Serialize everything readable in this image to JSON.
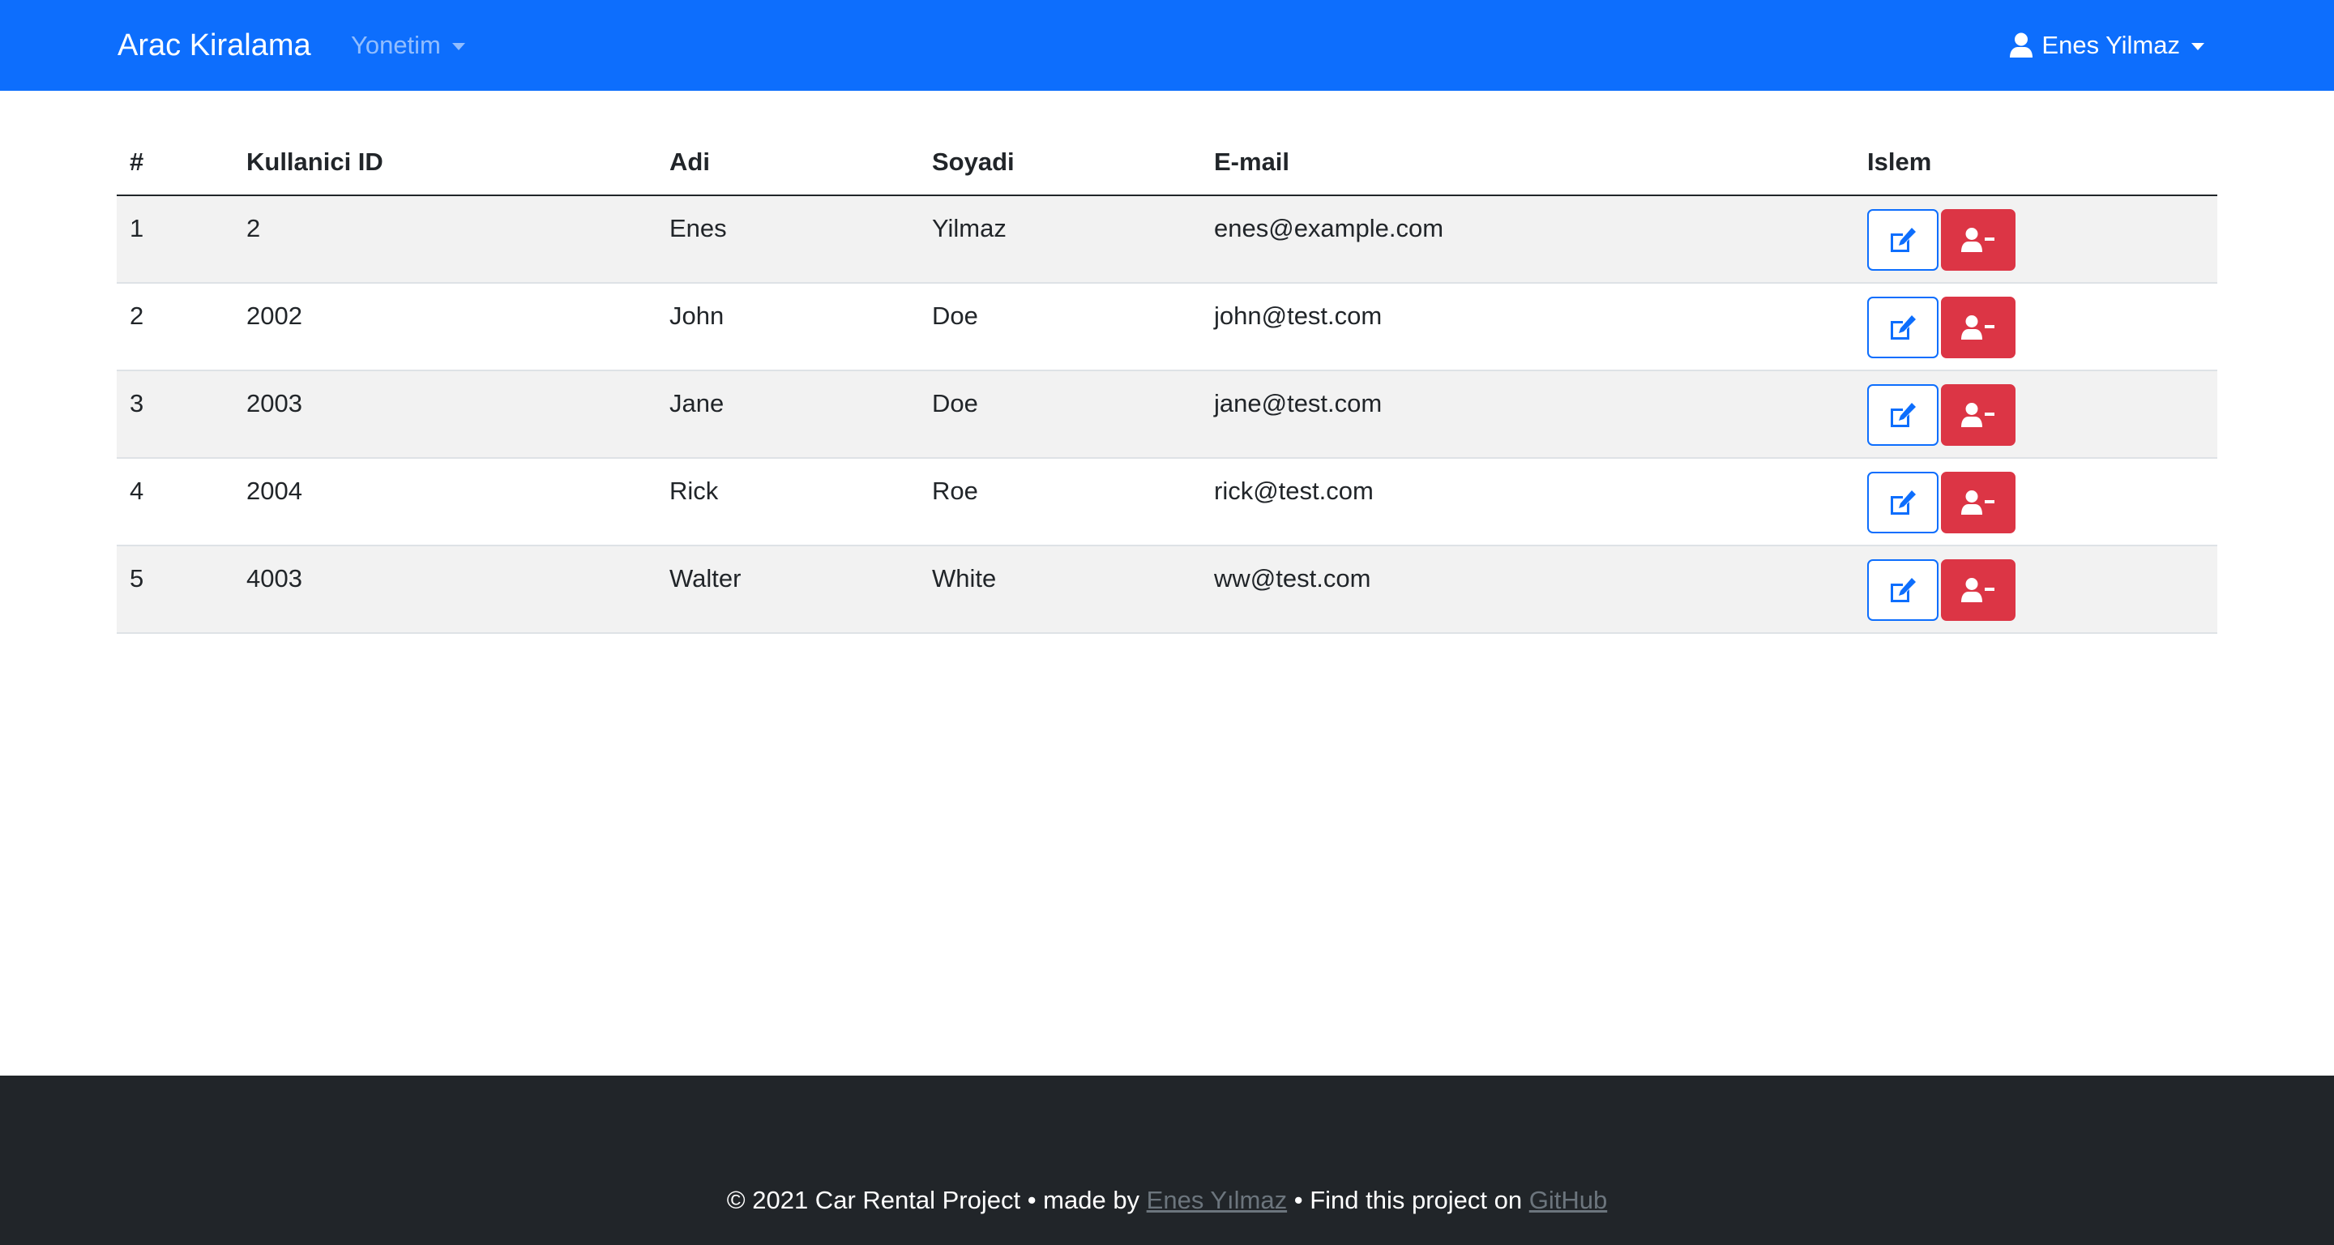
{
  "navbar": {
    "brand": "Arac Kiralama",
    "menu_label": "Yonetim",
    "user_label": "Enes Yilmaz",
    "bg_color": "#0d6efd"
  },
  "table": {
    "headers": {
      "num": "#",
      "user_id": "Kullanici ID",
      "first_name": "Adi",
      "last_name": "Soyadi",
      "email": "E-mail",
      "action": "Islem"
    },
    "rows": [
      {
        "num": "1",
        "user_id": "2",
        "first_name": "Enes",
        "last_name": "Yilmaz",
        "email": "enes@example.com"
      },
      {
        "num": "2",
        "user_id": "2002",
        "first_name": "John",
        "last_name": "Doe",
        "email": "john@test.com"
      },
      {
        "num": "3",
        "user_id": "2003",
        "first_name": "Jane",
        "last_name": "Doe",
        "email": "jane@test.com"
      },
      {
        "num": "4",
        "user_id": "2004",
        "first_name": "Rick",
        "last_name": "Roe",
        "email": "rick@test.com"
      },
      {
        "num": "5",
        "user_id": "4003",
        "first_name": "Walter",
        "last_name": "White",
        "email": "ww@test.com"
      }
    ],
    "row_actions": {
      "edit_icon": "edit-icon",
      "delete_icon": "user-minus-icon",
      "edit_color": "#0d6efd",
      "delete_color": "#dc3545"
    }
  },
  "footer": {
    "prefix": "© 2021 Car Rental Project • made by ",
    "author_link": "Enes Yılmaz",
    "middle": " • Find this project on ",
    "github_link": "GitHub",
    "bg_color": "#212529"
  }
}
